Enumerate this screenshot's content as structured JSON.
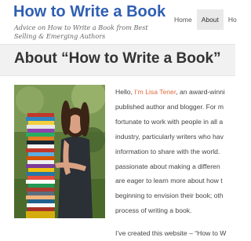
{
  "header": {
    "site_title": "How to Write a Book",
    "tagline": "Advice on How to Write a Book from Best Selling & Emerging Authors"
  },
  "nav": {
    "items": [
      {
        "label": "Home"
      },
      {
        "label": "About"
      },
      {
        "label": "Ho"
      }
    ],
    "active_index": 1
  },
  "page": {
    "title": "About “How to Write a Book”"
  },
  "bio": {
    "greeting": "Hello, ",
    "author_link": "I’m Lisa Tener",
    "line1_rest": ", an award-winni",
    "lines": [
      "published author and blogger. For m",
      "fortunate to work with people in all a",
      "industry, particularly writers who hav",
      "information to share with the world.",
      "passionate about making a differen",
      "are eager to learn more about how t",
      "beginning to envision their book; oth",
      "process of writing a book."
    ],
    "para2": "I’ve created this website – “How to W"
  },
  "photo": {
    "alt": "author-photo"
  },
  "colors": {
    "brand_blue": "#2f5fb3",
    "link_orange": "#e26a3c",
    "band_gray": "#f1f1f1"
  }
}
